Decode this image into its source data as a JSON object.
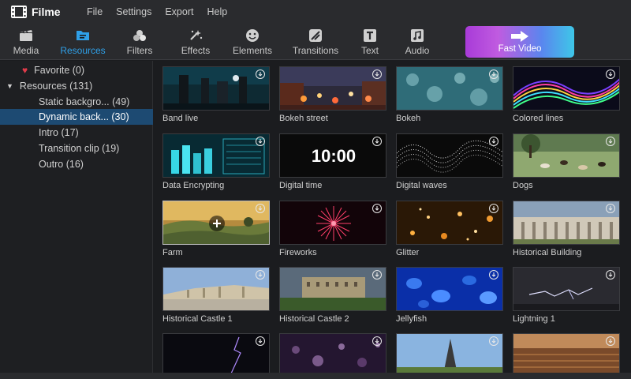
{
  "app": {
    "name": "Filme"
  },
  "menu": [
    "File",
    "Settings",
    "Export",
    "Help"
  ],
  "toolbar": {
    "tools": [
      {
        "label": "Media",
        "icon": "clapper-icon",
        "active": false
      },
      {
        "label": "Resources",
        "icon": "folder-icon",
        "active": true
      },
      {
        "label": "Filters",
        "icon": "filters-icon",
        "active": false
      },
      {
        "label": "Effects",
        "icon": "sparkle-icon",
        "active": false
      },
      {
        "label": "Elements",
        "icon": "smiley-icon",
        "active": false
      },
      {
        "label": "Transitions",
        "icon": "transition-icon",
        "active": false
      },
      {
        "label": "Text",
        "icon": "text-icon",
        "active": false
      },
      {
        "label": "Audio",
        "icon": "music-icon",
        "active": false
      }
    ],
    "fast_video": "Fast Video"
  },
  "sidebar": {
    "favorite": "Favorite (0)",
    "resources": "Resources (131)",
    "items": [
      {
        "label": "Static backgro... (49)",
        "selected": false
      },
      {
        "label": "Dynamic back... (30)",
        "selected": true
      },
      {
        "label": "Intro (17)",
        "selected": false
      },
      {
        "label": "Transition clip (19)",
        "selected": false
      },
      {
        "label": "Outro (16)",
        "selected": false
      }
    ]
  },
  "grid": {
    "digital_time_text": "10:00",
    "items": [
      "Band live",
      "Bokeh street",
      "Bokeh",
      "Colored lines",
      "Data Encrypting",
      "Digital time",
      "Digital waves",
      "Dogs",
      "Farm",
      "Fireworks",
      "Glitter",
      "Historical Building",
      "Historical Castle 1",
      "Historical Castle 2",
      "Jellyfish",
      "Lightning 1",
      "",
      "",
      "",
      ""
    ]
  },
  "colors": {
    "accent": "#2fa0e8",
    "selected_row": "#1d4a72",
    "heart": "#e03b4a"
  }
}
